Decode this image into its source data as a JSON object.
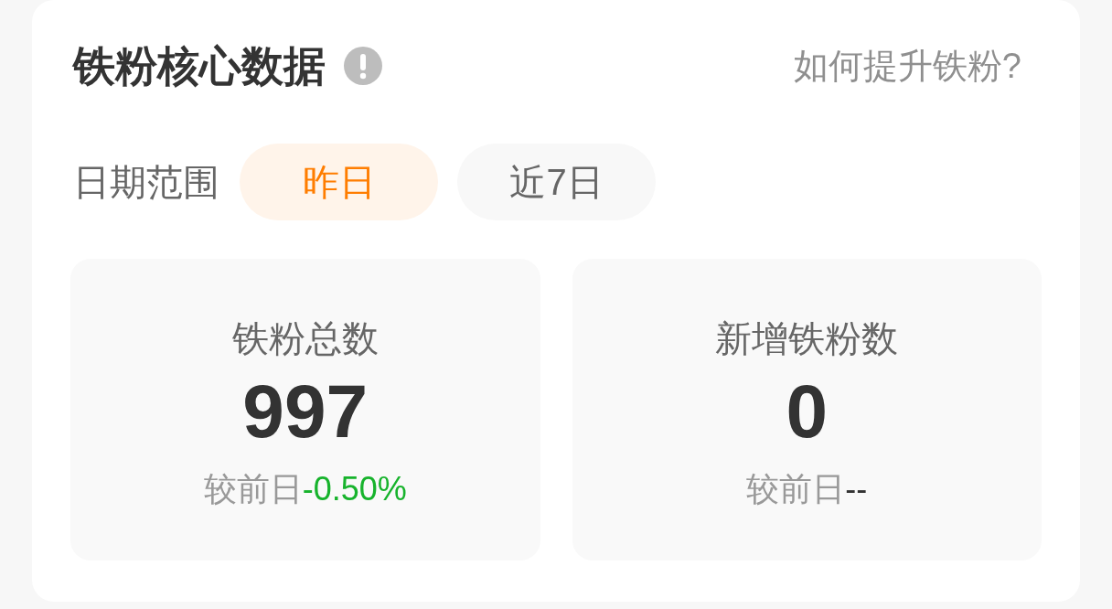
{
  "header": {
    "title": "铁粉核心数据",
    "help_link": "如何提升铁粉?"
  },
  "date_range": {
    "label": "日期范围",
    "options": [
      {
        "label": "昨日",
        "selected": true
      },
      {
        "label": "近7日",
        "selected": false
      }
    ]
  },
  "stats": [
    {
      "label": "铁粉总数",
      "value": "997",
      "compare_label": "较前日",
      "change": "-0.50%",
      "color": "#17b32c"
    },
    {
      "label": "新增铁粉数",
      "value": "0",
      "compare_label": "较前日",
      "change": "--",
      "color": "#333333"
    }
  ]
}
